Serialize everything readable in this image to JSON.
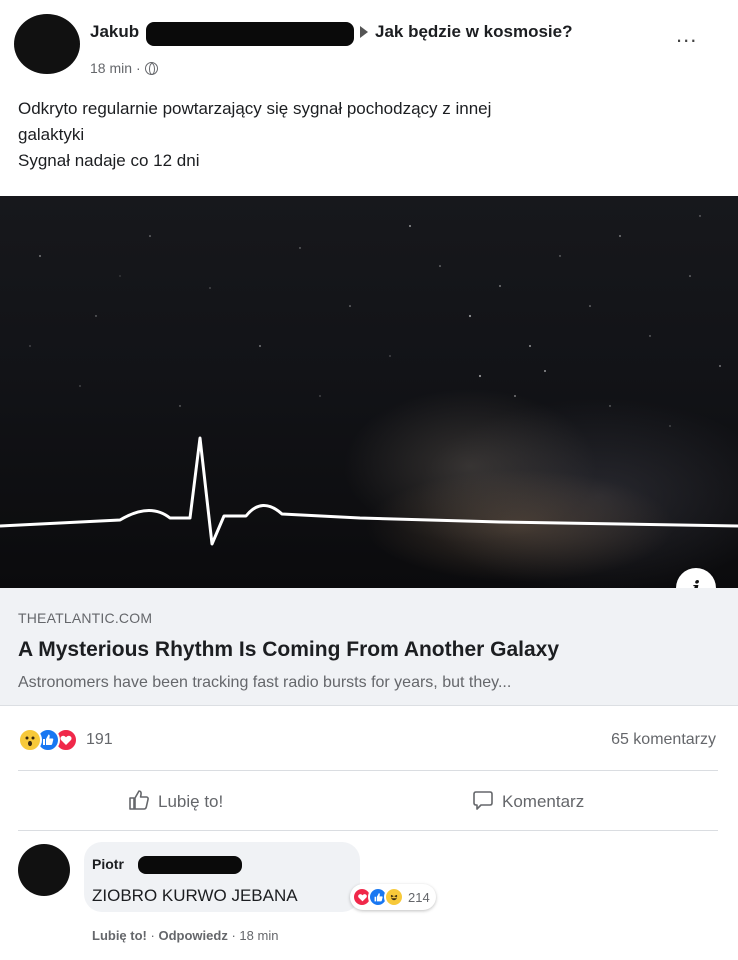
{
  "post": {
    "author_first_name": "Jakub",
    "group_name": "Jak będzie w kosmosie?",
    "timestamp": "18 min",
    "meta_separator": "·",
    "more_label": "...",
    "text_line1": "Odkryto regularnie powtarzający się sygnał pochodzący z innej",
    "text_line2": "galaktyki",
    "text_line3": "Sygnał nadaje co 12 dni"
  },
  "link": {
    "domain": "THEATLANTIC.COM",
    "title": "A Mysterious Rhythm Is Coming From Another Galaxy",
    "description": "Astronomers have been tracking fast radio bursts for years, but they..."
  },
  "reactions": {
    "types": [
      "wow",
      "like",
      "love"
    ],
    "count": "191",
    "comments": "65 komentarzy"
  },
  "actions": {
    "like_label": "Lubię to!",
    "comment_label": "Komentarz"
  },
  "comment": {
    "author_first_name": "Piotr",
    "text": "ZIOBRO KURWO JEBANA",
    "reaction_types": [
      "love",
      "like",
      "haha"
    ],
    "reaction_count": "214",
    "like_label": "Lubię to!",
    "reply_label": "Odpowiedz",
    "separator": "·",
    "timestamp": "18 min"
  },
  "colors": {
    "like_blue": "#1877f2",
    "love_red": "#f0284a",
    "wow_yellow": "#f7c93a",
    "secondary_text": "#65676b"
  }
}
